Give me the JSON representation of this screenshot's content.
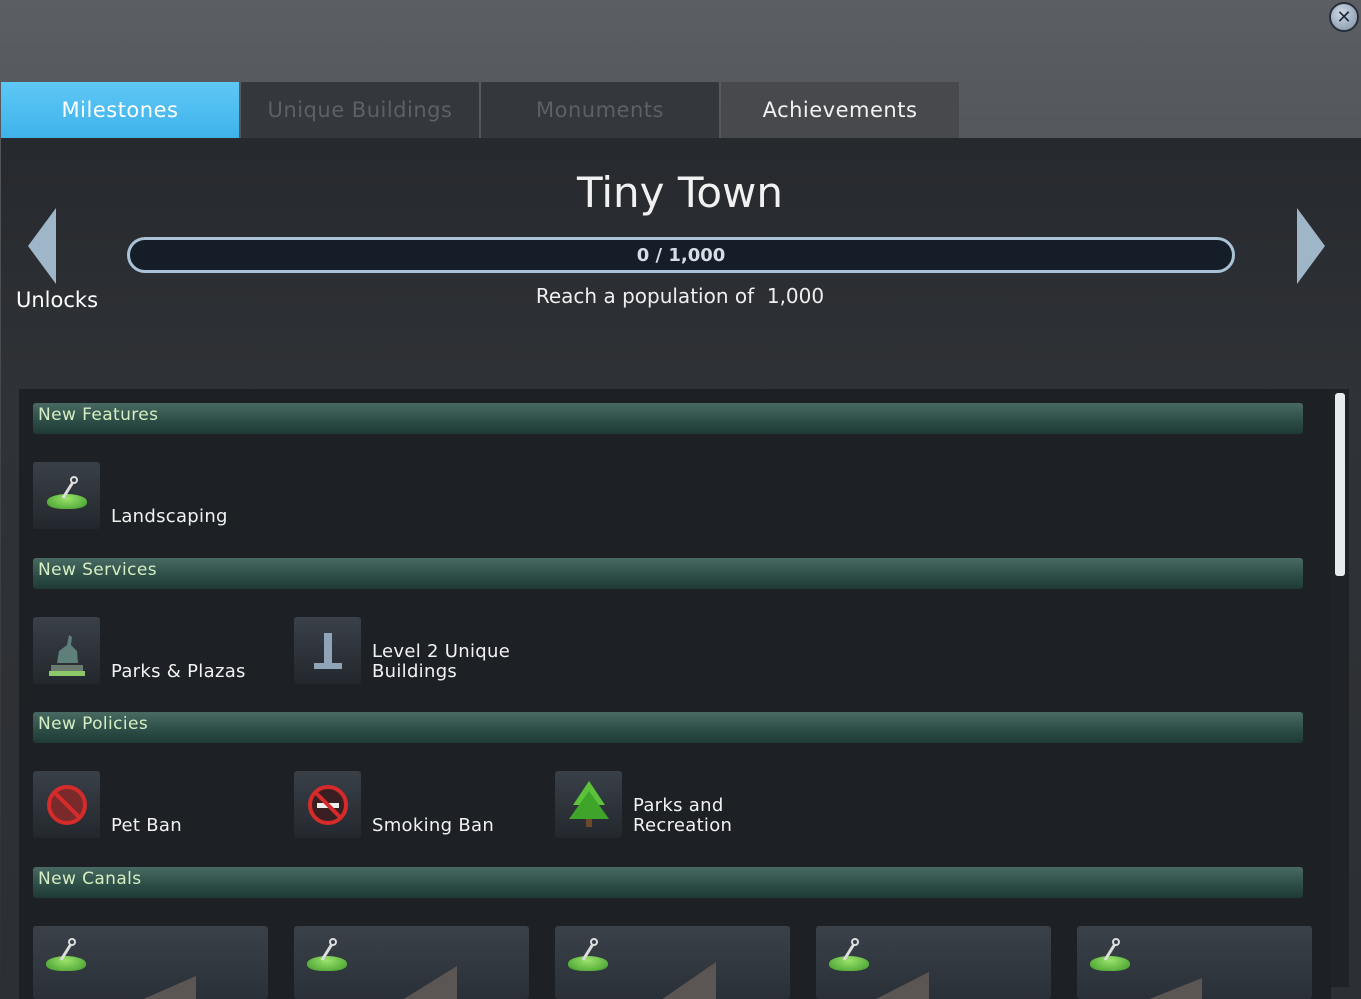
{
  "window": {
    "close_glyph": "✕"
  },
  "tabs": [
    {
      "label": "Milestones",
      "state": "active"
    },
    {
      "label": "Unique Buildings",
      "state": "disabled"
    },
    {
      "label": "Monuments",
      "state": "disabled"
    },
    {
      "label": "Achievements",
      "state": "normal"
    }
  ],
  "milestone": {
    "title": "Tiny Town",
    "progress_text": "0 / 1,000",
    "progress_fraction": 0,
    "goal": "Reach a population of  1,000",
    "unlocks_label": "Unlocks"
  },
  "sections": [
    {
      "header": "New Features",
      "items": [
        {
          "label": "Landscaping",
          "icon": "landscaping-icon"
        }
      ]
    },
    {
      "header": "New Services",
      "items": [
        {
          "label": "Parks & Plazas",
          "icon": "statue-icon"
        },
        {
          "label": "Level 2 Unique\nBuildings",
          "icon": "unique-building-icon"
        }
      ]
    },
    {
      "header": "New Policies",
      "items": [
        {
          "label": "Pet Ban",
          "icon": "pet-ban-icon"
        },
        {
          "label": "Smoking Ban",
          "icon": "smoking-ban-icon"
        },
        {
          "label": "Parks and\nRecreation",
          "icon": "tree-icon"
        }
      ]
    },
    {
      "header": "New Canals",
      "items": []
    }
  ],
  "colors": {
    "accent": "#4db8ef",
    "section": "#2e4e48",
    "progress_border": "#a9c2d6"
  }
}
